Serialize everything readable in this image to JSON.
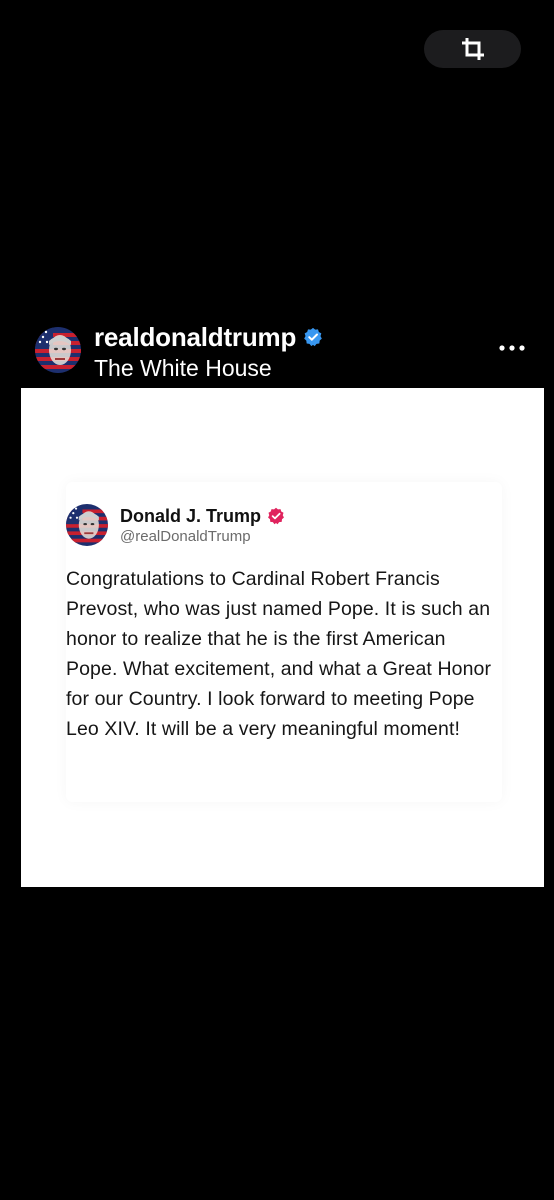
{
  "toolbar": {
    "crop_icon": "crop-icon"
  },
  "post": {
    "username": "realdonaldtrump",
    "subtitle": "The White House",
    "verified_icon": "verified-badge-icon",
    "more_icon": "more-options-icon",
    "colors": {
      "verified": "#3897f0",
      "background": "#000000"
    }
  },
  "tweet": {
    "name": "Donald J. Trump",
    "handle": "@realDonaldTrump",
    "verified_icon": "verified-badge-icon",
    "text": "Congratulations to Cardinal Robert Francis Prevost, who was just named Pope. It is such an honor to realize that he is the first American Pope. What excitement, and what a Great Honor for our Country. I look forward to meeting Pope Leo XIV. It will be a very meaningful moment!",
    "colors": {
      "verified": "#e0245e",
      "text": "#161616",
      "handle": "#6b6b6b"
    }
  }
}
